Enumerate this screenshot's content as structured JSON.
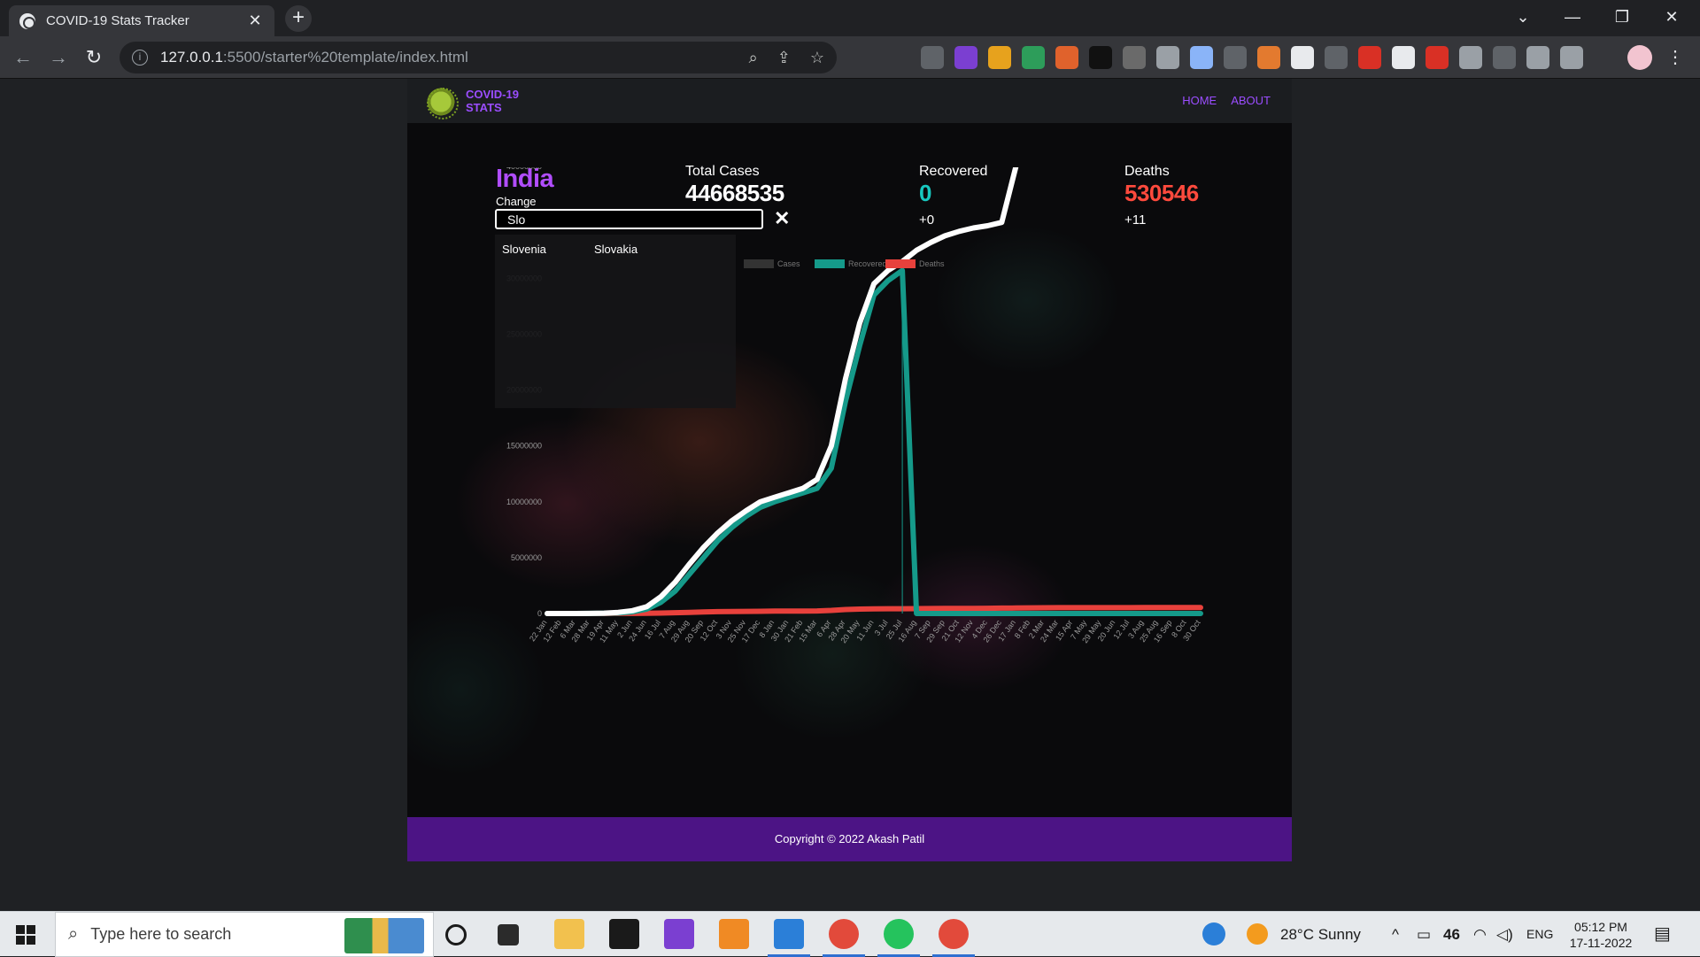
{
  "browser": {
    "tab_title": "COVID-19 Stats Tracker",
    "tab_close": "✕",
    "new_tab": "+",
    "url_host": "127.0.0.1",
    "url_path": ":5500/starter%20template/index.html",
    "win_minimize": "—",
    "win_restore": "❐",
    "win_close": "✕",
    "tab_search": "⌄"
  },
  "site": {
    "brand_line1": "COVID-19",
    "brand_line2": "STATS",
    "nav": [
      "HOME",
      "ABOUT"
    ],
    "country": "India",
    "change_label": "Change",
    "search_value": "Slo",
    "search_close": "✕",
    "suggestions": [
      "Slovenia",
      "Slovakia"
    ],
    "stats": {
      "total": {
        "label": "Total Cases",
        "value": "44668535",
        "delta": ""
      },
      "recovered": {
        "label": "Recovered",
        "value": "0",
        "delta": "+0"
      },
      "deaths": {
        "label": "Deaths",
        "value": "530546",
        "delta": "+11"
      }
    },
    "footer": "Copyright © 2022 Akash Patil"
  },
  "chart_data": {
    "type": "line",
    "legend": [
      "Cases",
      "Recovered",
      "Deaths"
    ],
    "legend_position": "top",
    "colors": {
      "Cases": "#ffffff",
      "Recovered": "#159a8a",
      "Deaths": "#e8413c"
    },
    "y_ticks": [
      "0",
      "5000000",
      "10000000",
      "15000000",
      "20000000",
      "25000000",
      "30000000",
      "35000000",
      "40000000",
      "45000000"
    ],
    "ylim": [
      0,
      45000000
    ],
    "x_labels": [
      "22 Jan",
      "12 Feb",
      "6 Mar",
      "28 Mar",
      "19 Apr",
      "11 May",
      "2 Jun",
      "24 Jun",
      "16 Jul",
      "7 Aug",
      "29 Aug",
      "20 Sep",
      "12 Oct",
      "3 Nov",
      "25 Nov",
      "17 Dec",
      "8 Jan",
      "30 Jan",
      "21 Feb",
      "15 Mar",
      "6 Apr",
      "28 Apr",
      "20 May",
      "11 Jun",
      "3 Jul",
      "25 Jul",
      "16 Aug",
      "7 Sep",
      "29 Sep",
      "21 Oct",
      "12 Nov",
      "4 Dec",
      "26 Dec",
      "17 Jan",
      "8 Feb",
      "2 Mar",
      "24 Mar",
      "15 Apr",
      "7 May",
      "29 May",
      "20 Jun",
      "12 Jul",
      "3 Aug",
      "25 Aug",
      "16 Sep",
      "8 Oct",
      "30 Oct"
    ],
    "series": [
      {
        "name": "Cases",
        "values": [
          0,
          0,
          0,
          10000,
          30000,
          100000,
          250000,
          600000,
          1500000,
          2800000,
          4400000,
          5900000,
          7200000,
          8300000,
          9200000,
          10000000,
          10400000,
          10800000,
          11200000,
          12000000,
          15000000,
          21000000,
          26000000,
          29500000,
          30700000,
          31500000,
          32500000,
          33200000,
          33800000,
          34200000,
          34500000,
          34700000,
          35000000,
          40000000,
          42000000,
          42900000,
          43000000,
          43050000,
          43100000,
          43150000,
          43300000,
          43700000,
          44100000,
          44400000,
          44550000,
          44630000,
          44668535
        ]
      },
      {
        "name": "Recovered",
        "values": [
          0,
          0,
          0,
          5000,
          20000,
          50000,
          150000,
          400000,
          1000000,
          2000000,
          3500000,
          5000000,
          6500000,
          7700000,
          8700000,
          9500000,
          10000000,
          10400000,
          10800000,
          11200000,
          13000000,
          19000000,
          24000000,
          28500000,
          29800000,
          30700000,
          0,
          0,
          0,
          0,
          0,
          0,
          0,
          0,
          0,
          0,
          0,
          0,
          0,
          0,
          0,
          0,
          0,
          0,
          0,
          0,
          0
        ]
      },
      {
        "name": "Deaths",
        "values": [
          0,
          0,
          0,
          0,
          1000,
          5000,
          10000,
          20000,
          40000,
          70000,
          100000,
          140000,
          165000,
          180000,
          190000,
          200000,
          210000,
          215000,
          220000,
          230000,
          280000,
          360000,
          400000,
          420000,
          425000,
          430000,
          435000,
          440000,
          450000,
          455000,
          460000,
          470000,
          480000,
          490000,
          510000,
          515000,
          520000,
          521000,
          522000,
          524000,
          525000,
          526000,
          527000,
          528000,
          529000,
          530000,
          530546
        ]
      }
    ]
  },
  "taskbar": {
    "search_placeholder": "Type here to search",
    "weather": "28°C  Sunny",
    "battery": "46",
    "lang": "ENG",
    "time": "05:12 PM",
    "date": "17-11-2022",
    "notifications": "1"
  }
}
